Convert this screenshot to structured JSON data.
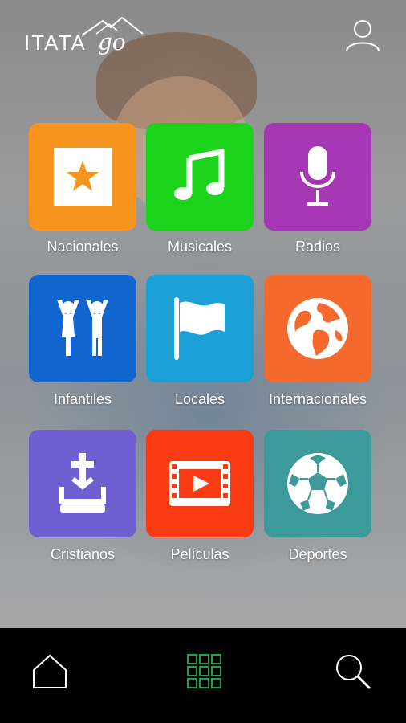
{
  "header": {
    "logo_main": "ITATA",
    "logo_suffix": "go"
  },
  "categories": [
    {
      "label": "Nacionales",
      "color": "#f7941d",
      "icon": "star-frame-icon"
    },
    {
      "label": "Musicales",
      "color": "#1bd31b",
      "icon": "music-note-icon"
    },
    {
      "label": "Radios",
      "color": "#a637b5",
      "icon": "microphone-icon"
    },
    {
      "label": "Infantiles",
      "color": "#1165cf",
      "icon": "children-icon"
    },
    {
      "label": "Locales",
      "color": "#1a9fd6",
      "icon": "flag-icon"
    },
    {
      "label": "Internacionales",
      "color": "#f56a2c",
      "icon": "globe-icon"
    },
    {
      "label": "Cristianos",
      "color": "#6f5fd0",
      "icon": "cross-bible-icon"
    },
    {
      "label": "Películas",
      "color": "#fa3a12",
      "icon": "film-play-icon"
    },
    {
      "label": "Deportes",
      "color": "#3c9a9a",
      "icon": "soccer-ball-icon"
    }
  ],
  "bottom_nav": [
    {
      "icon": "home-icon",
      "active": false
    },
    {
      "icon": "grid-icon",
      "active": true,
      "accent": "#1fa34a"
    },
    {
      "icon": "search-icon",
      "active": false
    }
  ]
}
